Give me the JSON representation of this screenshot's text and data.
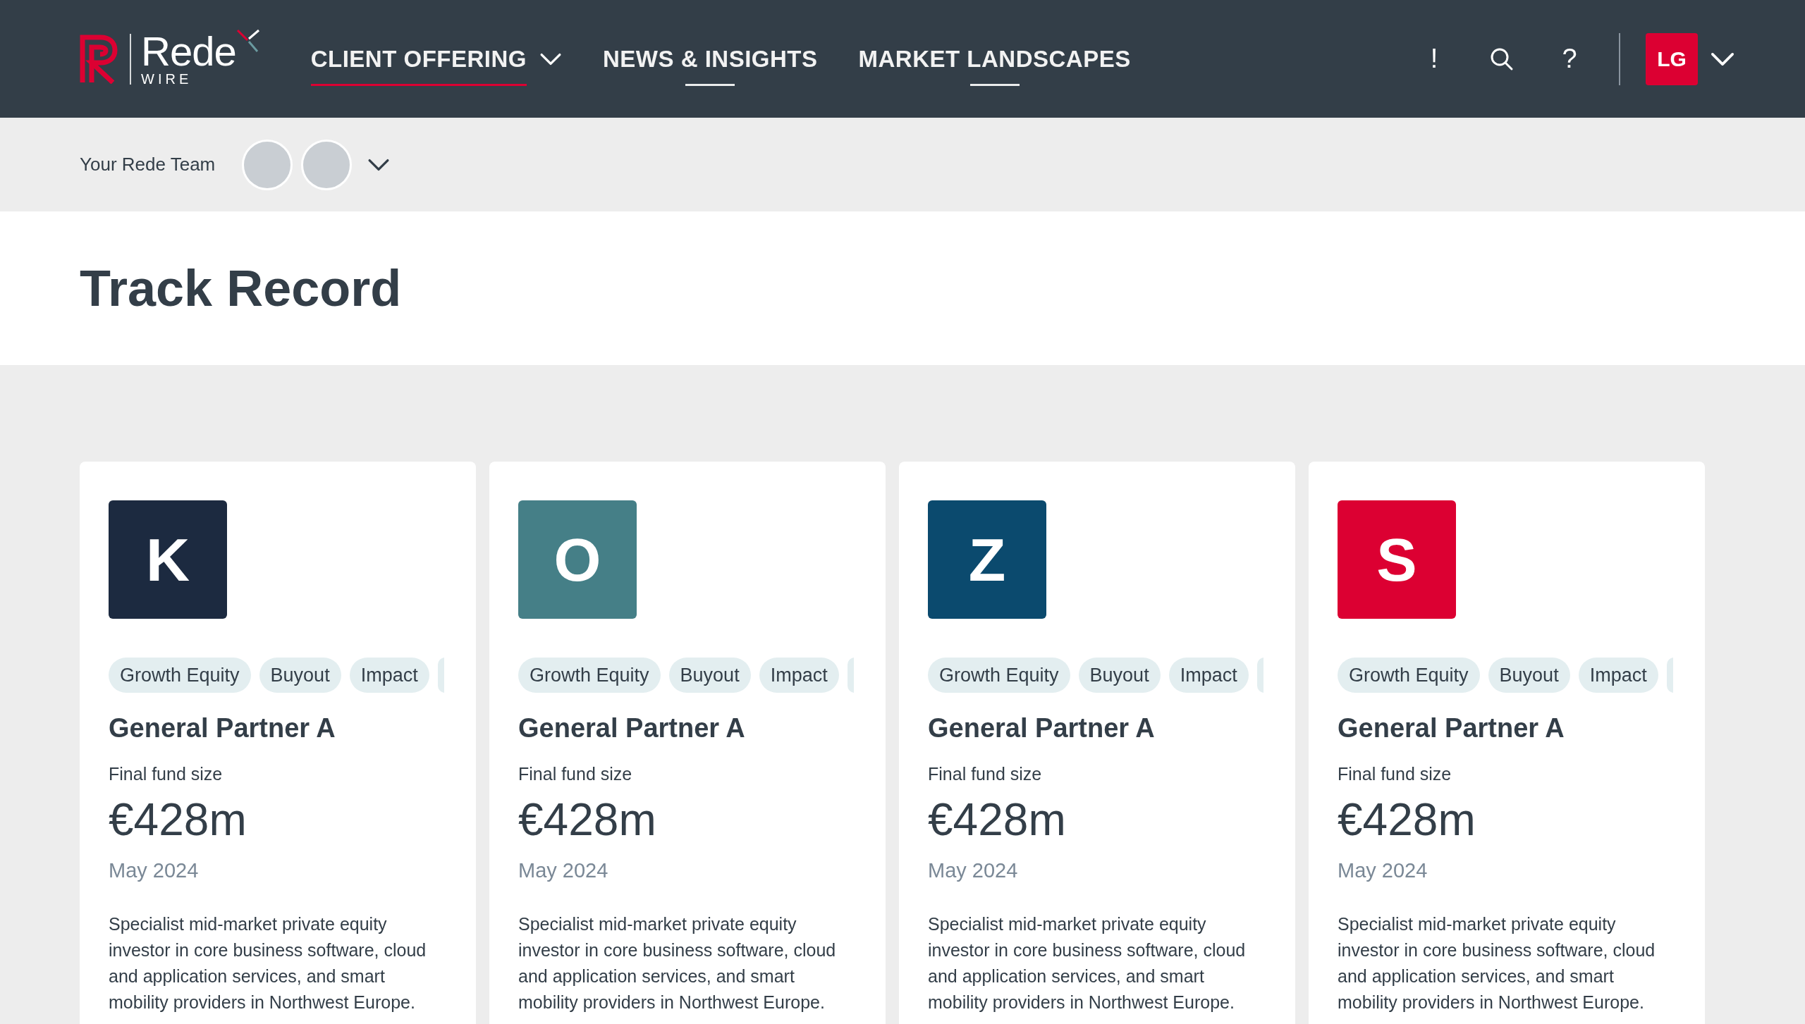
{
  "header": {
    "logo": {
      "name": "Rede",
      "sub": "WIRE"
    },
    "nav": [
      {
        "label": "CLIENT OFFERING",
        "selected": true,
        "dropdown": true
      },
      {
        "label": "NEWS & INSIGHTS",
        "selected": false,
        "dropdown": false
      },
      {
        "label": "MARKET LANDSCAPES",
        "selected": false,
        "dropdown": false
      }
    ],
    "alert": "!",
    "help": "?",
    "user_initials": "LG"
  },
  "team_bar": {
    "label": "Your Rede Team",
    "members": [
      {
        "kind": "photo"
      },
      {
        "kind": "photo"
      }
    ]
  },
  "page_title": "Track Record",
  "cards": [
    {
      "letter": "K",
      "color": "#1c2a40",
      "tags": [
        "Growth Equity",
        "Buyout",
        "Impact"
      ],
      "title": "General Partner A",
      "fund_label": "Final fund size",
      "amount": "€428m",
      "date": "May 2024",
      "description": "Specialist mid-market private equity investor in core business software, cloud and application services, and smart mobility providers in Northwest Europe."
    },
    {
      "letter": "O",
      "color": "#457f87",
      "tags": [
        "Growth Equity",
        "Buyout",
        "Impact"
      ],
      "title": "General Partner A",
      "fund_label": "Final fund size",
      "amount": "€428m",
      "date": "May 2024",
      "description": "Specialist mid-market private equity investor in core business software, cloud and application services, and smart mobility providers in Northwest Europe."
    },
    {
      "letter": "Z",
      "color": "#0b4a6e",
      "tags": [
        "Growth Equity",
        "Buyout",
        "Impact"
      ],
      "title": "General Partner A",
      "fund_label": "Final fund size",
      "amount": "€428m",
      "date": "May 2024",
      "description": "Specialist mid-market private equity investor in core business software, cloud and application services, and smart mobility providers in Northwest Europe."
    },
    {
      "letter": "S",
      "color": "#dc0032",
      "tags": [
        "Growth Equity",
        "Buyout",
        "Impact"
      ],
      "title": "General Partner A",
      "fund_label": "Final fund size",
      "amount": "€428m",
      "date": "May 2024",
      "description": "Specialist mid-market private equity investor in core business software, cloud and application services, and smart mobility providers in Northwest Europe."
    }
  ]
}
